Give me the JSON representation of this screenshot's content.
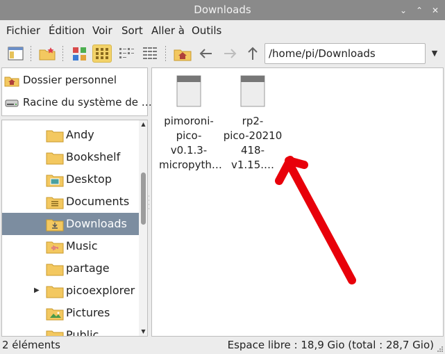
{
  "window": {
    "title": "Downloads"
  },
  "menu": [
    "Fichier",
    "Édition",
    "Voir",
    "Sort",
    "Aller à",
    "Outils"
  ],
  "address": {
    "path": "/home/pi/Downloads"
  },
  "places": [
    {
      "label": "Dossier personnel",
      "icon": "home-icon"
    },
    {
      "label": "Racine du système de …",
      "icon": "drive-icon"
    }
  ],
  "tree": [
    {
      "label": "Andy",
      "icon": "folder-icon",
      "selected": false,
      "expandable": false
    },
    {
      "label": "Bookshelf",
      "icon": "folder-icon",
      "selected": false,
      "expandable": false
    },
    {
      "label": "Desktop",
      "icon": "desktop-folder-icon",
      "selected": false,
      "expandable": false
    },
    {
      "label": "Documents",
      "icon": "documents-folder-icon",
      "selected": false,
      "expandable": false
    },
    {
      "label": "Downloads",
      "icon": "downloads-folder-icon",
      "selected": true,
      "expandable": false
    },
    {
      "label": "Music",
      "icon": "music-folder-icon",
      "selected": false,
      "expandable": false
    },
    {
      "label": "partage",
      "icon": "folder-icon",
      "selected": false,
      "expandable": false
    },
    {
      "label": "picoexplorer",
      "icon": "folder-icon",
      "selected": false,
      "expandable": true
    },
    {
      "label": "Pictures",
      "icon": "pictures-folder-icon",
      "selected": false,
      "expandable": false
    },
    {
      "label": "Public",
      "icon": "folder-icon",
      "selected": false,
      "expandable": false
    }
  ],
  "files": [
    {
      "name_lines": [
        "pimoroni-",
        "pico-v0.1.3-",
        "micropyth…"
      ],
      "icon": "file-icon"
    },
    {
      "name_lines": [
        "rp2-",
        "pico-20210",
        "418-v1.15.…"
      ],
      "icon": "file-icon"
    }
  ],
  "status": {
    "count": "2 éléments",
    "free_space": "Espace libre : 18,9 Gio (total : 28,7 Gio)"
  },
  "colors": {
    "titlebar": "#8a8a8a",
    "selection": "#7c8da0",
    "folder": "#f3c860",
    "annotation_arrow": "#e8000a"
  }
}
